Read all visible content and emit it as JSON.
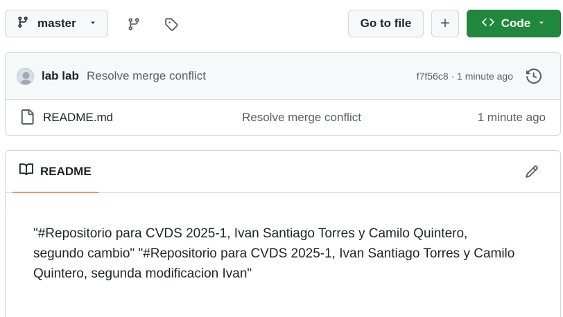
{
  "toolbar": {
    "branch_label": "master",
    "goto_file_label": "Go to file",
    "plus_label": "+",
    "code_label": "Code"
  },
  "commit": {
    "author": "lab lab",
    "message": "Resolve merge conflict",
    "meta": "f7f56c8 · 1 minute ago"
  },
  "files": [
    {
      "name": "README.md",
      "commit_message": "Resolve merge conflict",
      "time": "1 minute ago"
    }
  ],
  "readme": {
    "tab_label": "README",
    "content": "\"#Repositorio para CVDS 2025-1, Ivan Santiago Torres y Camilo Quintero, segundo cambio\" \"#Repositorio para CVDS 2025-1, Ivan Santiago Torres y Camilo Quintero, segunda modificacion Ivan\""
  },
  "icons": {
    "branch": "git-branch-icon",
    "branches": "branches-icon",
    "tags": "tag-icon",
    "history": "history-icon",
    "file": "file-icon",
    "book": "book-icon",
    "edit": "pencil-icon",
    "code": "code-icon"
  },
  "colors": {
    "code_button": "#1f883d",
    "tab_underline": "#fd8c73",
    "border": "#d0d7de",
    "muted_text": "#57606a"
  }
}
